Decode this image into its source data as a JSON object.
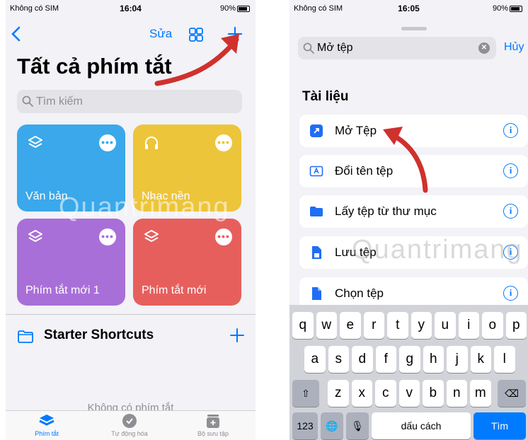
{
  "left_screen": {
    "status": {
      "carrier": "Không có SIM",
      "time": "16:04",
      "battery": "90%"
    },
    "nav": {
      "edit": "Sửa"
    },
    "title": "Tất cả phím tắt",
    "search": {
      "placeholder": "Tìm kiếm"
    },
    "tiles": [
      {
        "label": "Văn bản",
        "icon": "layers-icon",
        "color": "#3aa8ea"
      },
      {
        "label": "Nhạc nền",
        "icon": "headphones-icon",
        "color": "#edc53b"
      },
      {
        "label": "Phím tắt mới 1",
        "icon": "layers-icon",
        "color": "#a96fd8"
      },
      {
        "label": "Phím tắt mới",
        "icon": "layers-icon",
        "color": "#e65f5d"
      }
    ],
    "more_glyph": "•••",
    "starter": {
      "title": "Starter Shortcuts"
    },
    "empty_text": "Không có phím tắt",
    "tabs": [
      {
        "label": "Phím tắt",
        "icon": "shortcuts-stack-icon",
        "active": true
      },
      {
        "label": "Tự động hóa",
        "icon": "automation-icon",
        "active": false
      },
      {
        "label": "Bộ sưu tập",
        "icon": "gallery-icon",
        "active": false
      }
    ]
  },
  "right_screen": {
    "status": {
      "carrier": "Không có SIM",
      "time": "16:05",
      "battery": "90%"
    },
    "search": {
      "value": "Mở tệp",
      "cancel": "Hủy"
    },
    "section": "Tài liệu",
    "rows": [
      {
        "label": "Mở Tệp",
        "icon": "open-file-icon",
        "icon_color": "#1f6ef5"
      },
      {
        "label": "Đổi tên tệp",
        "icon": "rename-file-icon",
        "icon_color": "#1f6ef5"
      },
      {
        "label": "Lấy tệp từ thư mục",
        "icon": "folder-icon",
        "icon_color": "#1f6ef5"
      },
      {
        "label": "Lưu tệp",
        "icon": "save-file-icon",
        "icon_color": "#1f6ef5"
      },
      {
        "label": "Chọn tệp",
        "icon": "document-icon",
        "icon_color": "#1f6ef5"
      }
    ],
    "info_glyph": "i",
    "keyboard": {
      "row1": [
        "q",
        "w",
        "e",
        "r",
        "t",
        "y",
        "u",
        "i",
        "o",
        "p"
      ],
      "row2": [
        "a",
        "s",
        "d",
        "f",
        "g",
        "h",
        "j",
        "k",
        "l"
      ],
      "row3": [
        "z",
        "x",
        "c",
        "v",
        "b",
        "n",
        "m"
      ],
      "shift": "⇧",
      "delete": "⌫",
      "numbers": "123",
      "globe": "🌐",
      "mic": "🎙",
      "space": "dấu cách",
      "go": "Tìm"
    }
  },
  "watermark": "Quantrimang",
  "colors": {
    "accent": "#007aff",
    "arrow": "#d0312d"
  }
}
